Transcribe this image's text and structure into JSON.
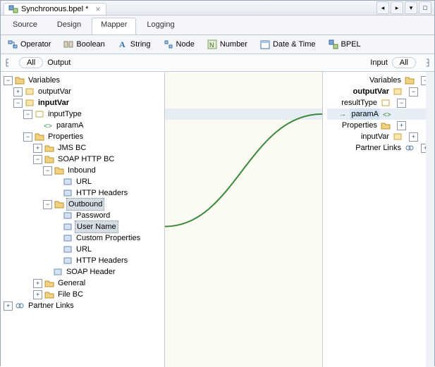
{
  "title": {
    "filename": "Synchronous.bpel *"
  },
  "subtabs": [
    "Source",
    "Design",
    "Mapper",
    "Logging"
  ],
  "activeSubtab": 2,
  "toolbar": {
    "operator": "Operator",
    "boolean": "Boolean",
    "string": "String",
    "node": "Node",
    "number": "Number",
    "datetime": "Date & Time",
    "bpel": "BPEL"
  },
  "optionbar": {
    "left_all": "All",
    "left_output": "Output",
    "right_input": "Input",
    "right_all": "All"
  },
  "leftTree": {
    "root": "Variables",
    "outputVar": "outputVar",
    "inputVar": "inputVar",
    "inputType": "inputType",
    "paramA": "paramA",
    "properties": "Properties",
    "jmsbc": "JMS BC",
    "soaphttpbc": "SOAP HTTP BC",
    "inbound": "Inbound",
    "in_url": "URL",
    "in_httphdr": "HTTP Headers",
    "outbound": "Outbound",
    "out_password": "Password",
    "out_username": "User Name",
    "out_custom": "Custom Properties",
    "out_url": "URL",
    "out_httphdr": "HTTP Headers",
    "soapheader": "SOAP Header",
    "general": "General",
    "filebc": "File BC",
    "partnerLinks": "Partner Links"
  },
  "rightTree": {
    "variables": "Variables",
    "outputVar": "outputVar",
    "resultType": "resultType",
    "paramA": "paramA",
    "properties": "Properties",
    "inputVar": "inputVar",
    "partnerLinks": "Partner Links"
  },
  "mapping": {
    "from": "User Name",
    "to": "paramA"
  }
}
